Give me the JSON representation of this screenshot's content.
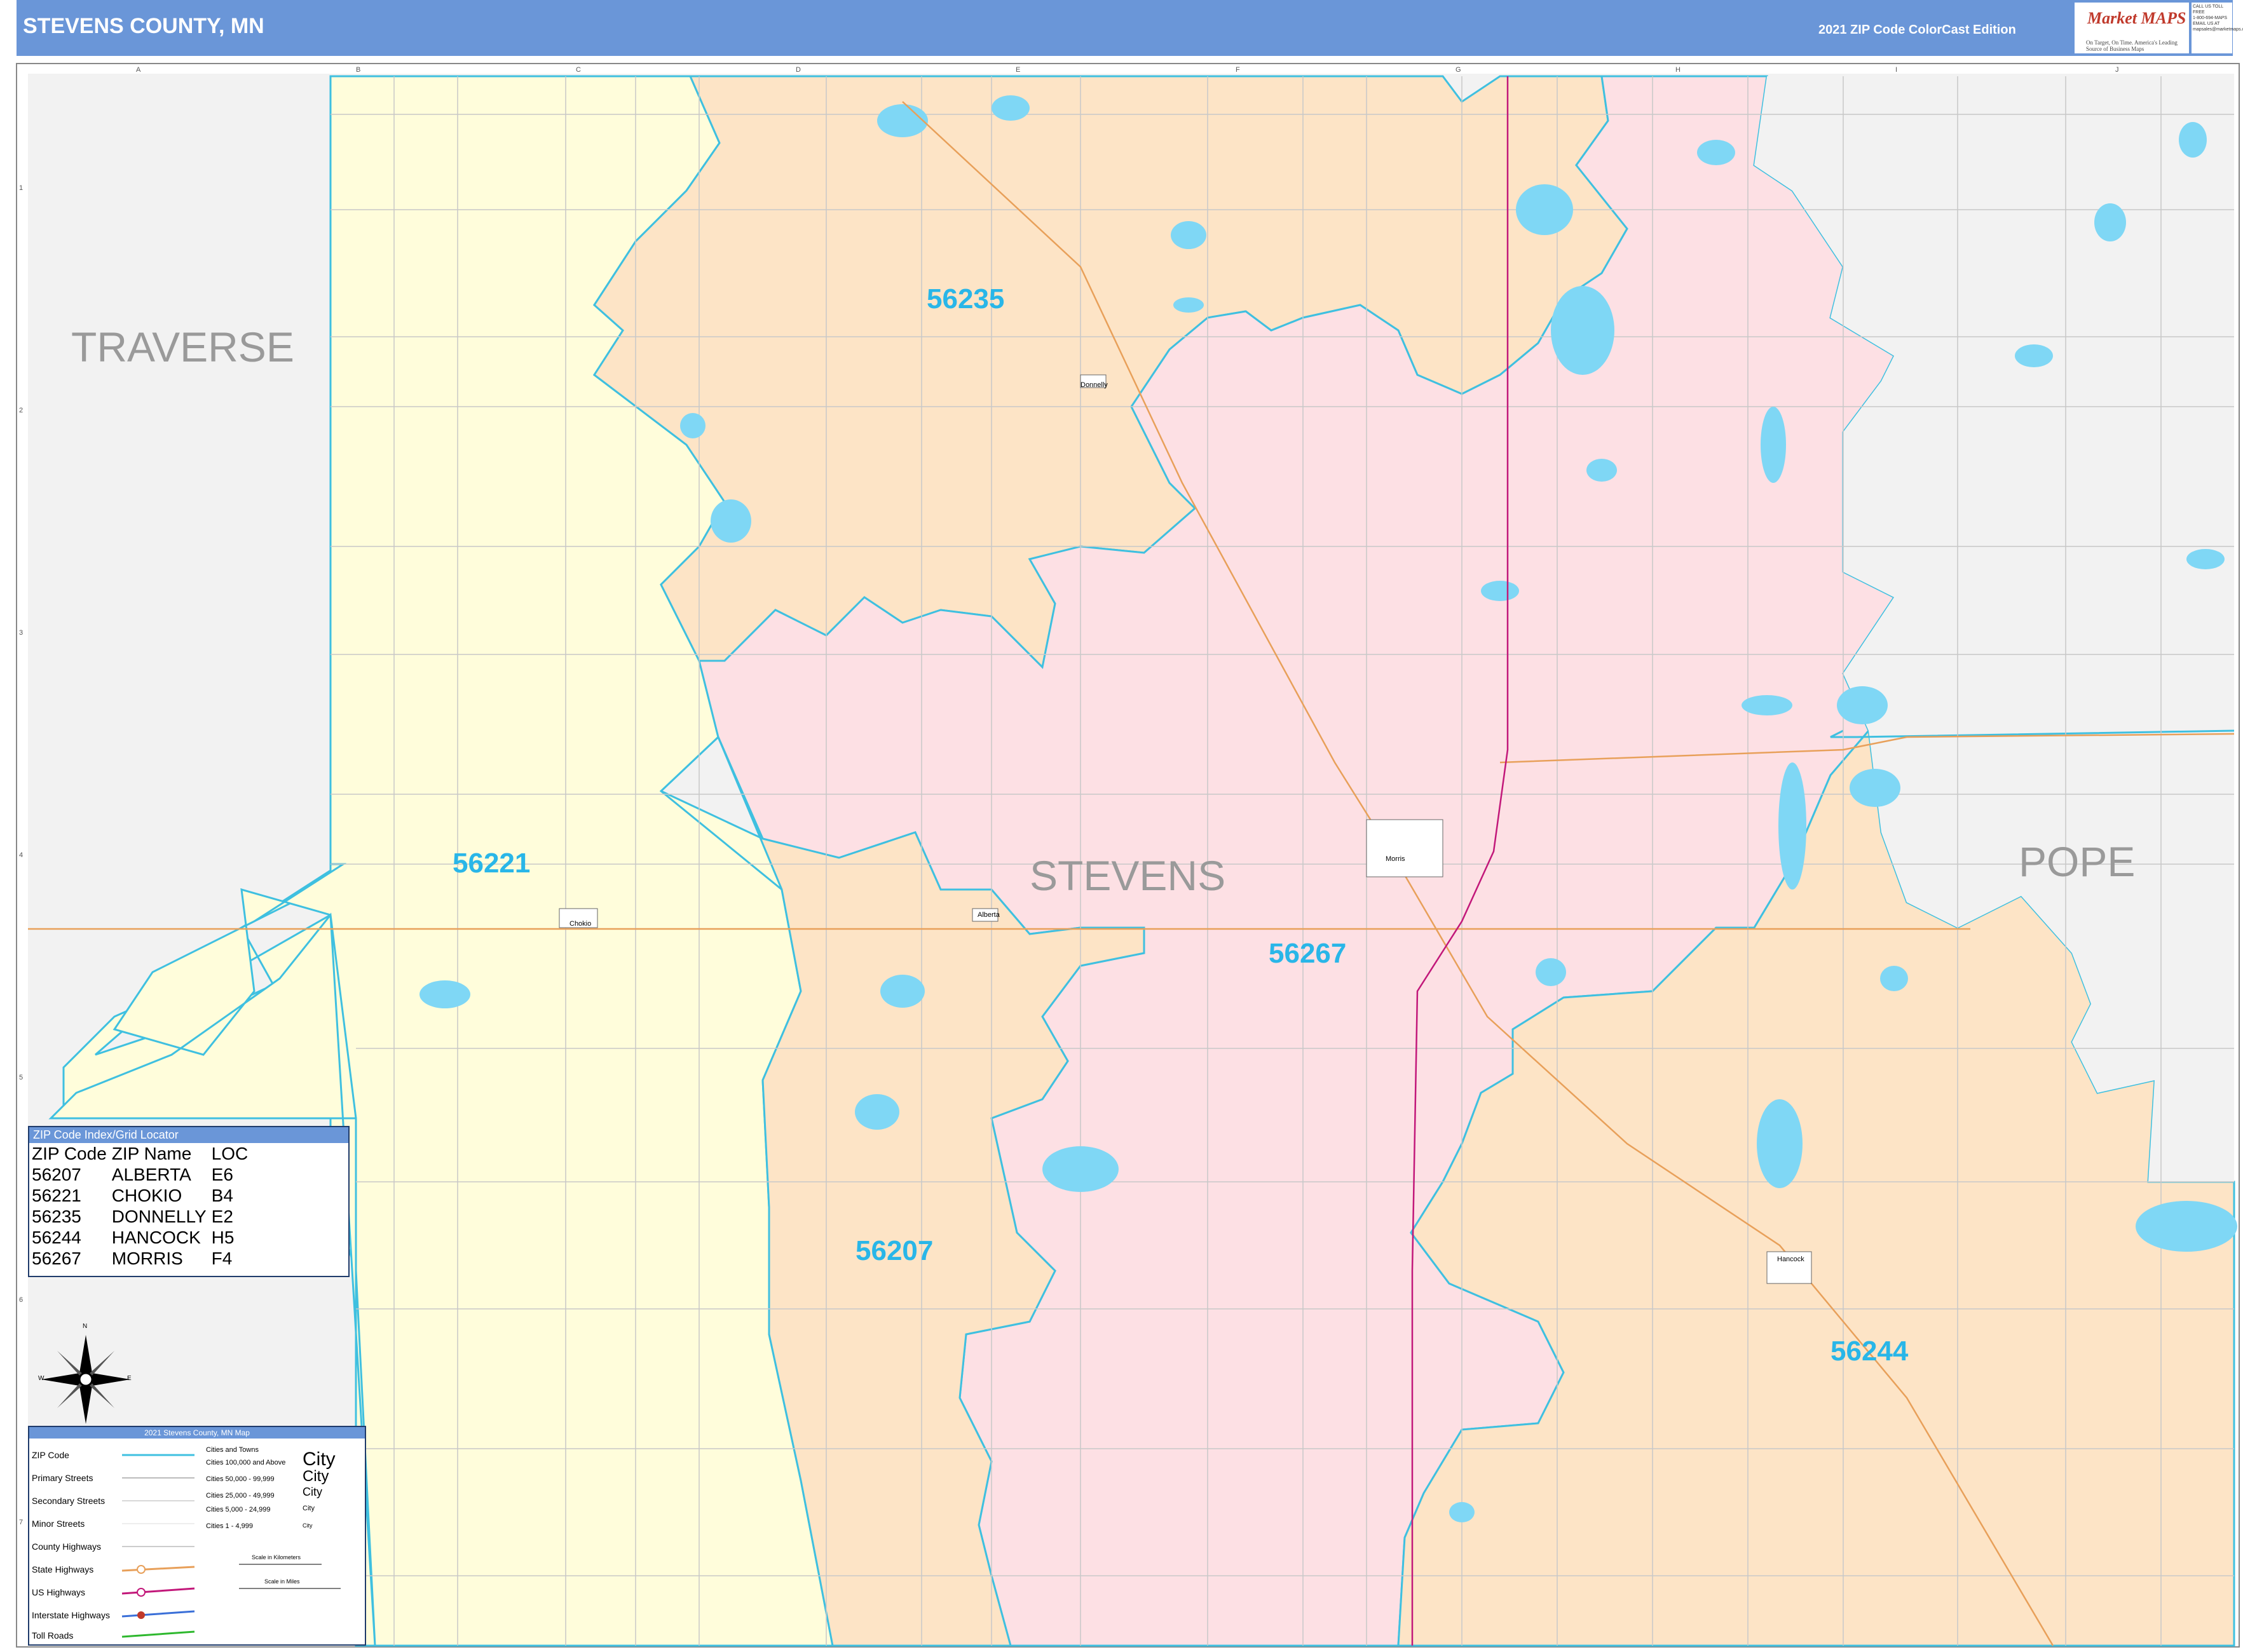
{
  "header": {
    "title": "STEVENS COUNTY, MN",
    "edition": "2021 ZIP Code ColorCast Edition",
    "logo_text": "Market MAPS",
    "logo_tagline": "On Target, On Time. America's Leading Source of Business Maps",
    "contact_lines": [
      "CALL US TOLL FREE",
      "1-800-694-MAPS",
      "EMAIL US AT",
      "mapsales@marketmaps.com"
    ]
  },
  "map": {
    "county_label": "STEVENS",
    "neighbor_labels": [
      "TRAVERSE",
      "POPE"
    ],
    "zip_labels": [
      "56235",
      "56221",
      "56267",
      "56207",
      "56244"
    ],
    "grid_columns": [
      "A",
      "B",
      "C",
      "D",
      "E",
      "F",
      "G",
      "H",
      "I",
      "J"
    ],
    "grid_rows": [
      "1",
      "2",
      "3",
      "4",
      "5",
      "6",
      "7"
    ],
    "towns": [
      "Donnelly",
      "Morris",
      "Chokio",
      "Alberta",
      "Hancock"
    ],
    "colors": {
      "zip_56221": "#fffddb",
      "zip_56235": "#fde4c6",
      "zip_56267": "#fde0e4",
      "zip_56207": "#fde4c6",
      "zip_56244": "#fde4c6",
      "outside": "#f2f2f2",
      "zip_boundary": "#3fc0e0",
      "water": "#7fd7f5",
      "us_highway": "#c2187a",
      "state_highway": "#e8a05a"
    }
  },
  "zip_index": {
    "title": "ZIP Code Index/Grid Locator",
    "headers": [
      "ZIP Code",
      "ZIP Name",
      "LOC"
    ],
    "rows": [
      [
        "56207",
        "ALBERTA",
        "E6"
      ],
      [
        "56221",
        "CHOKIO",
        "B4"
      ],
      [
        "56235",
        "DONNELLY",
        "E2"
      ],
      [
        "56244",
        "HANCOCK",
        "H5"
      ],
      [
        "56267",
        "MORRIS",
        "F4"
      ]
    ]
  },
  "compass": {
    "n": "N",
    "s": "S",
    "e": "E",
    "w": "W"
  },
  "legend": {
    "title": "2021 Stevens County, MN Map",
    "items": [
      "ZIP Code",
      "Primary Streets",
      "Secondary Streets",
      "Minor Streets",
      "County Highways",
      "State Highways",
      "US Highways",
      "Interstate Highways",
      "Toll Roads"
    ],
    "city_header": "Cities and Towns",
    "city_classes": [
      "Cities 100,000 and Above",
      "Cities 50,000 - 99,999",
      "Cities 25,000 - 49,999",
      "Cities 5,000 - 24,999",
      "Cities 1 - 4,999"
    ],
    "city_samples": [
      "City",
      "City",
      "City",
      "City",
      "City"
    ],
    "scale_km": "Scale in Kilometers",
    "scale_mi": "Scale in Miles"
  }
}
